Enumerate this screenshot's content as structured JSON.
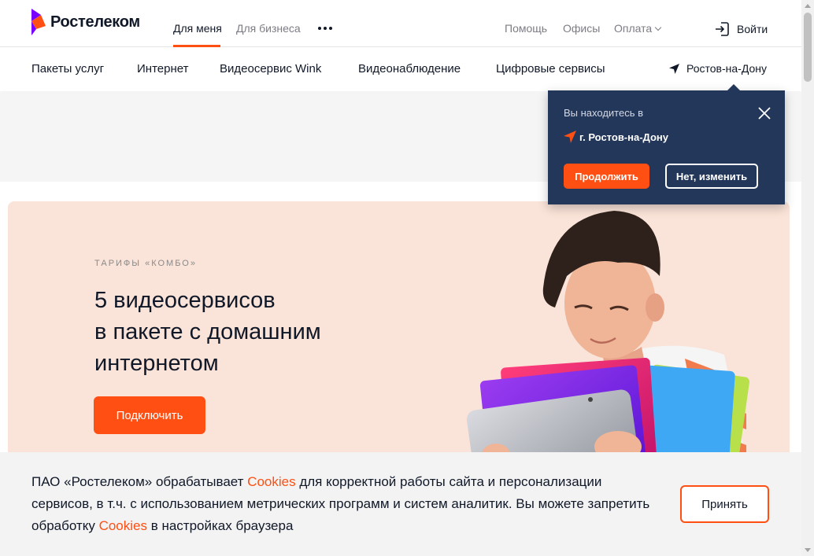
{
  "header": {
    "logo_text": "Ростелеком",
    "segments": [
      {
        "label": "Для меня",
        "active": true
      },
      {
        "label": "Для бизнеса",
        "active": false
      }
    ],
    "utility_links": [
      "Помощь",
      "Офисы",
      "Оплата"
    ],
    "login_label": "Войти"
  },
  "nav": {
    "items": [
      "Пакеты услуг",
      "Интернет",
      "Видеосервис Wink",
      "Видеонаблюдение",
      "Цифровые сервисы"
    ],
    "city": "Ростов-на-Дону"
  },
  "location_popup": {
    "hint": "Вы находитесь в",
    "city": "г. Ростов-на-Дону",
    "continue_label": "Продолжить",
    "change_label": "Нет, изменить"
  },
  "hero": {
    "eyebrow": "ТАРИФЫ «КОМБО»",
    "title_lines": [
      "5 видеосервисов",
      "в пакете с домашним",
      "интернетом"
    ],
    "cta_label": "Подключить"
  },
  "cookie": {
    "text_part1": "ПАО «Ростелеком» обрабатывает ",
    "link1": "Cookies",
    "text_part2": " для корректной работы сайта и персонализации сервисов, в т.ч. с использованием метрических программ и систем аналитик. Вы можете запретить обработку ",
    "link2": "Cookies",
    "text_part3": " в настройках браузера",
    "accept_label": "Принять"
  },
  "colors": {
    "brand_orange": "#ff4f12",
    "brand_purple": "#7700ff",
    "popup_bg": "#23375a",
    "hero_bg": "#fae3d8"
  },
  "icons": {
    "logo": "rostelecom-logo-icon",
    "more": "more-dots-icon",
    "login": "login-icon",
    "location": "location-arrow-icon",
    "close": "close-icon"
  }
}
